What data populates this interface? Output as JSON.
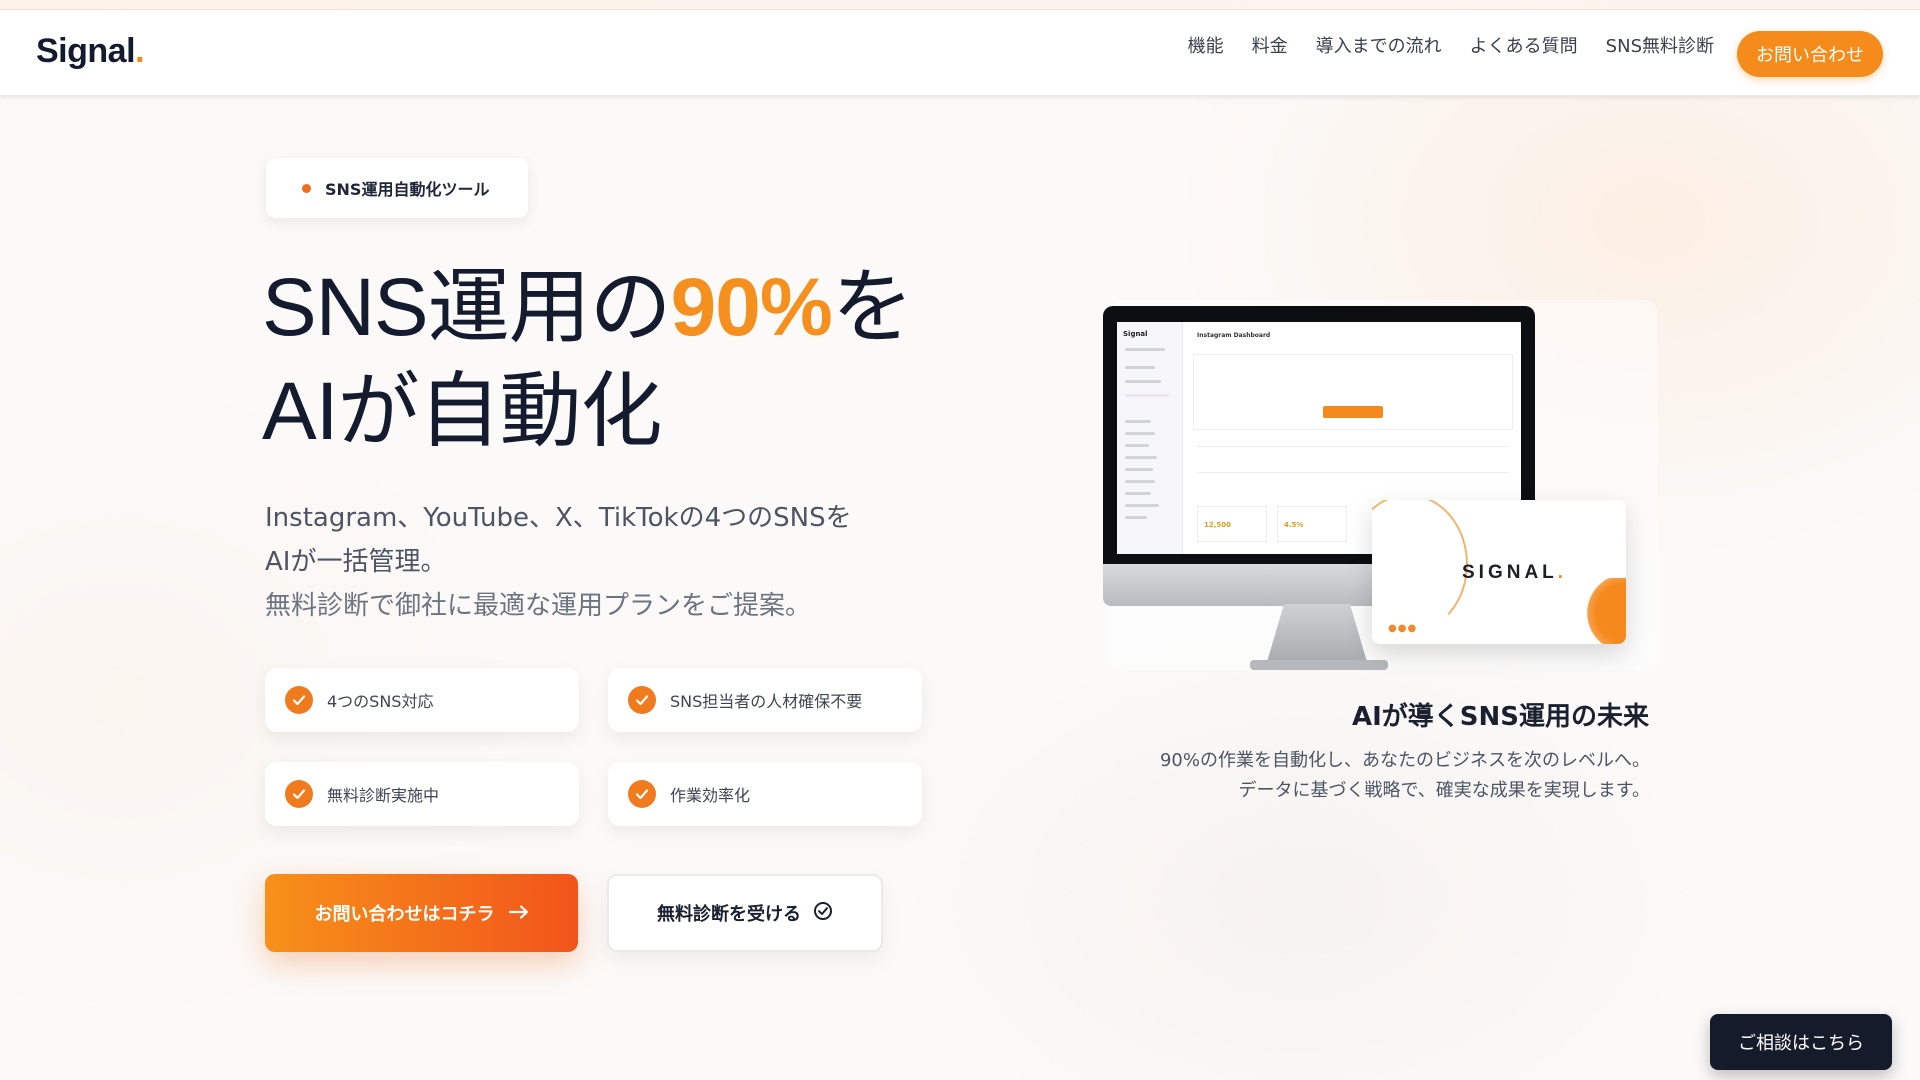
{
  "header": {
    "logo_text": "Signal",
    "logo_dot": ".",
    "nav": [
      "機能",
      "料金",
      "導入までの流れ",
      "よくある質問",
      "SNS無料診断"
    ],
    "cta": "お問い合わせ"
  },
  "hero": {
    "tag": "SNS運用自動化ツール",
    "headline_part1": "SNS運用の",
    "headline_accent": "90%",
    "headline_part2": "を",
    "headline_line2": "AIが自動化",
    "sub_line1": "Instagram、YouTube、X、TikTokの4つのSNSを",
    "sub_line2": "AIが一括管理。",
    "sub_line3": "無料診断で御社に最適な運用プランをご提案。",
    "features": [
      "4つのSNS対応",
      "SNS担当者の人材確保不要",
      "無料診断実施中",
      "作業効率化"
    ],
    "primary_button": "お問い合わせはコチラ",
    "secondary_button": "無料診断を受ける"
  },
  "visual": {
    "screen_brand": "Signal",
    "screen_title": "Instagram Dashboard",
    "stat_1": "12,500",
    "stat_2": "4.5%",
    "card_logo": "SIGNAL",
    "title": "AIが導くSNS運用の未来",
    "desc_line1": "90%の作業を自動化し、あなたのビジネスを次のレベルへ。",
    "desc_line2": "データに基づく戦略で、確実な成果を実現します。"
  },
  "float_button": "ご相談はこちら",
  "colors": {
    "accent": "#f58b1a",
    "navy": "#141b2e"
  }
}
